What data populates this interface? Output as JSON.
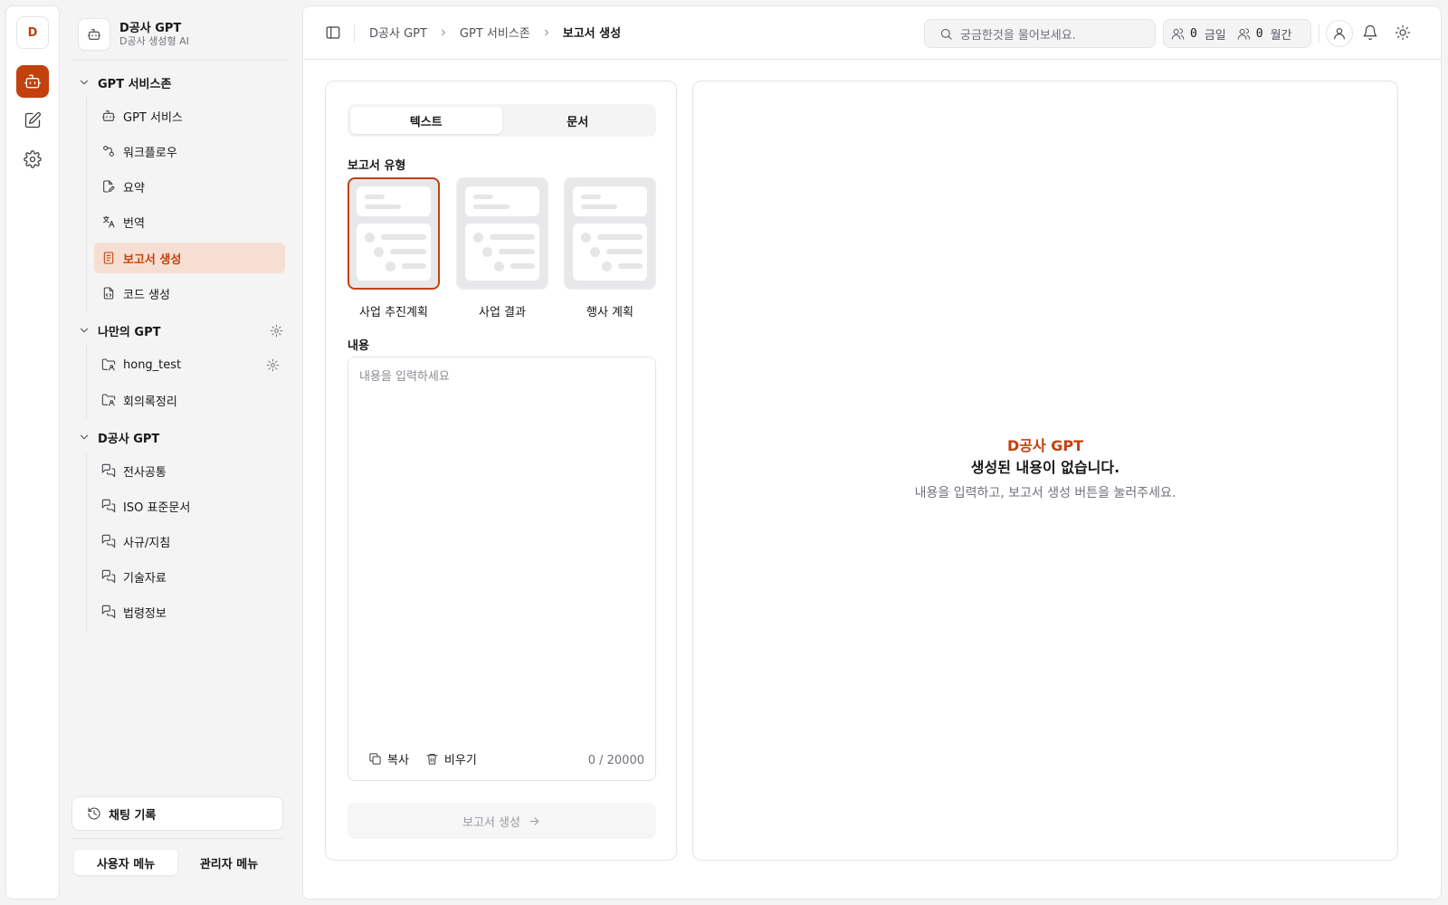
{
  "rail": {
    "logo_letter": "D",
    "icons": [
      "bot-icon",
      "edit-icon",
      "settings-icon"
    ]
  },
  "brand": {
    "name": "D공사 GPT",
    "subtitle": "D공사 생성형 AI"
  },
  "sidebar": {
    "groups": [
      {
        "label": "GPT 서비스존",
        "items": [
          {
            "label": "GPT 서비스",
            "icon": "bot-icon"
          },
          {
            "label": "워크플로우",
            "icon": "workflow-icon"
          },
          {
            "label": "요약",
            "icon": "file-edit-icon"
          },
          {
            "label": "번역",
            "icon": "languages-icon"
          },
          {
            "label": "보고서 생성",
            "icon": "report-icon",
            "active": true
          },
          {
            "label": "코드 생성",
            "icon": "file-code-icon"
          }
        ]
      },
      {
        "label": "나만의 GPT",
        "items": [
          {
            "label": "hong_test",
            "icon": "folder-user-icon"
          },
          {
            "label": "회의록정리",
            "icon": "folder-user-icon"
          }
        ]
      },
      {
        "label": "D공사 GPT",
        "items": [
          {
            "label": "전사공통",
            "icon": "messages-icon"
          },
          {
            "label": "ISO 표준문서",
            "icon": "messages-icon"
          },
          {
            "label": "사규/지침",
            "icon": "messages-icon"
          },
          {
            "label": "기술자료",
            "icon": "messages-icon"
          },
          {
            "label": "법령정보",
            "icon": "messages-icon"
          }
        ]
      }
    ],
    "chat_history": "채팅 기록",
    "menu_toggle": {
      "user": "사용자 메뉴",
      "admin": "관리자 메뉴",
      "selected": "user"
    }
  },
  "topbar": {
    "breadcrumbs": [
      "D공사 GPT",
      "GPT 서비스존",
      "보고서 생성"
    ],
    "search_placeholder": "궁금한것을 물어보세요.",
    "stats": [
      {
        "count": "0",
        "label": "금일"
      },
      {
        "count": "0",
        "label": "월간"
      }
    ]
  },
  "form": {
    "tabs": [
      "텍스트",
      "문서"
    ],
    "active_tab": "텍스트",
    "report_type_label": "보고서 유형",
    "report_types": [
      "사업 추진계획",
      "사업 결과",
      "행사 계획"
    ],
    "selected_report_type": "사업 추진계획",
    "content_label": "내용",
    "content_placeholder": "내용을 입력하세요",
    "copy_label": "복사",
    "clear_label": "비우기",
    "char_count": "0 / 20000",
    "generate_label": "보고서 생성"
  },
  "output": {
    "brand": "D공사 GPT",
    "title": "생성된 내용이 없습니다.",
    "description": "내용을 입력하고, 보고서 생성 버튼을 눌러주세요."
  },
  "colors": {
    "accent": "#c2410c",
    "active_bg": "#f6dfd2",
    "border": "#e4e4e7",
    "background": "#f4f4f5"
  }
}
